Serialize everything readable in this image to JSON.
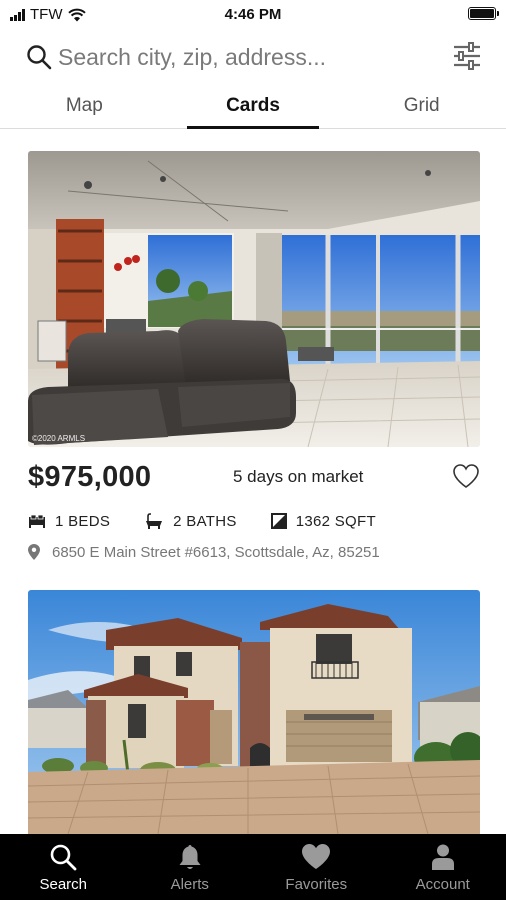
{
  "status_bar": {
    "carrier": "TFW",
    "time": "4:46 PM"
  },
  "search": {
    "placeholder": "Search city, zip, address..."
  },
  "tabs": [
    {
      "label": "Map",
      "active": false
    },
    {
      "label": "Cards",
      "active": true
    },
    {
      "label": "Grid",
      "active": false
    }
  ],
  "listings": [
    {
      "watermark": "©2020 ARMLS",
      "price": "$975,000",
      "days_on_market": "5 days on market",
      "beds": "1 BEDS",
      "baths": "2 BATHS",
      "sqft": "1362 SQFT",
      "address": "6850 E Main Street #6613, Scottsdale, Az, 85251"
    },
    {
      "watermark": ""
    }
  ],
  "bottom_nav": [
    {
      "label": "Search",
      "icon": "search-icon",
      "active": true
    },
    {
      "label": "Alerts",
      "icon": "bell-icon",
      "active": false
    },
    {
      "label": "Favorites",
      "icon": "heart-icon",
      "active": false
    },
    {
      "label": "Account",
      "icon": "person-icon",
      "active": false
    }
  ],
  "colors": {
    "nav_background": "#000000",
    "nav_active": "#ffffff",
    "nav_inactive": "#9a9a9a",
    "text_primary": "#222222",
    "text_secondary": "#777777"
  }
}
